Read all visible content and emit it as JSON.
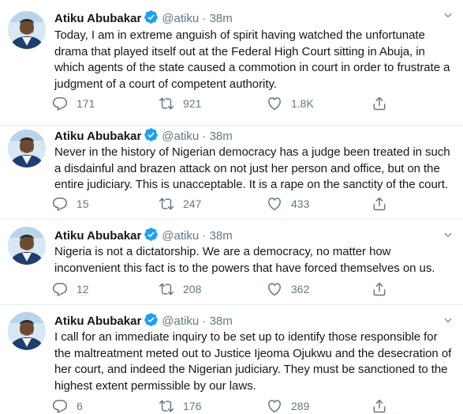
{
  "tweets": [
    {
      "name": "Atiku Abubakar",
      "handle": "@atiku",
      "separator": "·",
      "time": "38m",
      "text": "Today, I am in extreme anguish of spirit having watched the unfortunate drama that played itself out at the Federal High Court sitting in Abuja, in which agents of the state caused a commotion in court in order to frustrate a judgment of a court of competent authority.",
      "replies": "171",
      "retweets": "921",
      "likes": "1.8K"
    },
    {
      "name": "Atiku Abubakar",
      "handle": "@atiku",
      "separator": "·",
      "time": "38m",
      "text": "Never in the history of Nigerian democracy has a judge been treated in such a disdainful and brazen attack on not just her person and office, but on the entire judiciary. This is unacceptable. It is a rape on the sanctity of the court.",
      "replies": "15",
      "retweets": "247",
      "likes": "433"
    },
    {
      "name": "Atiku Abubakar",
      "handle": "@atiku",
      "separator": "·",
      "time": "38m",
      "text": "Nigeria is not a dictatorship. We are a democracy, no matter how inconvenient this fact is to the powers that have forced themselves on us.",
      "replies": "12",
      "retweets": "208",
      "likes": "362"
    },
    {
      "name": "Atiku Abubakar",
      "handle": "@atiku",
      "separator": "·",
      "time": "38m",
      "text": "I call for an immediate inquiry to be set up to identify those responsible for the maltreatment meted out to Justice Ijeoma Ojukwu and the desecration of her court, and indeed the Nigerian judiciary. They must be sanctioned to the highest extent permissible by our laws.",
      "replies": "6",
      "retweets": "176",
      "likes": "289"
    }
  ],
  "icons": {
    "verified": "verified-badge-icon",
    "reply": "reply-icon",
    "retweet": "retweet-icon",
    "like": "like-icon",
    "share": "share-icon",
    "menu": "chevron-down-icon"
  },
  "colors": {
    "name": "#14171a",
    "secondary": "#657786",
    "verified": "#1da1f2",
    "divider": "#e6ecf0"
  }
}
